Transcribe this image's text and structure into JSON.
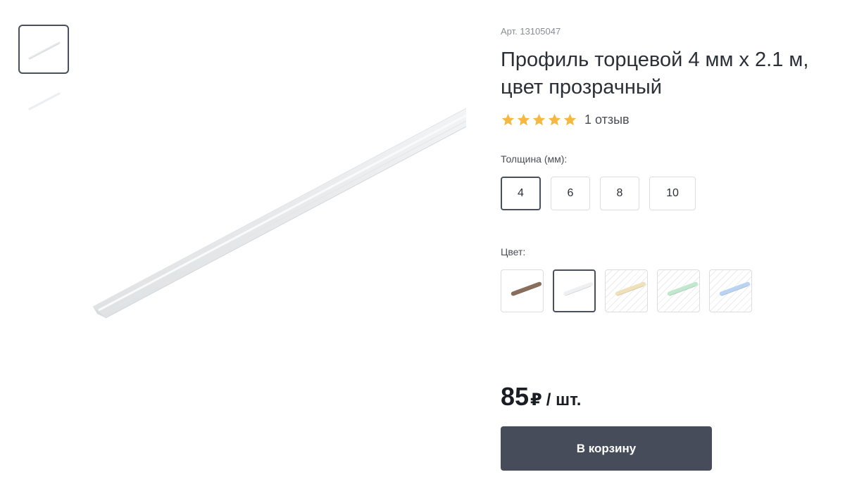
{
  "product": {
    "article": "Арт. 13105047",
    "title": "Профиль торцевой 4 мм х 2.1 м, цвет прозрачный",
    "rating": 5,
    "reviews": "1 отзыв"
  },
  "thumbnails": [
    {
      "selected": true
    },
    {
      "selected": false
    }
  ],
  "thickness": {
    "label": "Толщина (мм):",
    "options": [
      "4",
      "6",
      "8",
      "10"
    ],
    "selected": "4"
  },
  "color": {
    "label": "Цвет:",
    "swatches": [
      {
        "color": "#8a6e5c",
        "available": true,
        "selected": false
      },
      {
        "color": "#eef0f2",
        "available": true,
        "selected": true
      },
      {
        "color": "#efe1b8",
        "available": false,
        "selected": false
      },
      {
        "color": "#bfe8cf",
        "available": false,
        "selected": false
      },
      {
        "color": "#b9d4f2",
        "available": false,
        "selected": false
      }
    ]
  },
  "price": {
    "amount": "85",
    "currency": "₽",
    "unit": "/ шт."
  },
  "cart_button": "В корзину",
  "colors": {
    "star": "#f5b942",
    "button_bg": "#474c5a",
    "active_border": "#4a4f5c"
  }
}
